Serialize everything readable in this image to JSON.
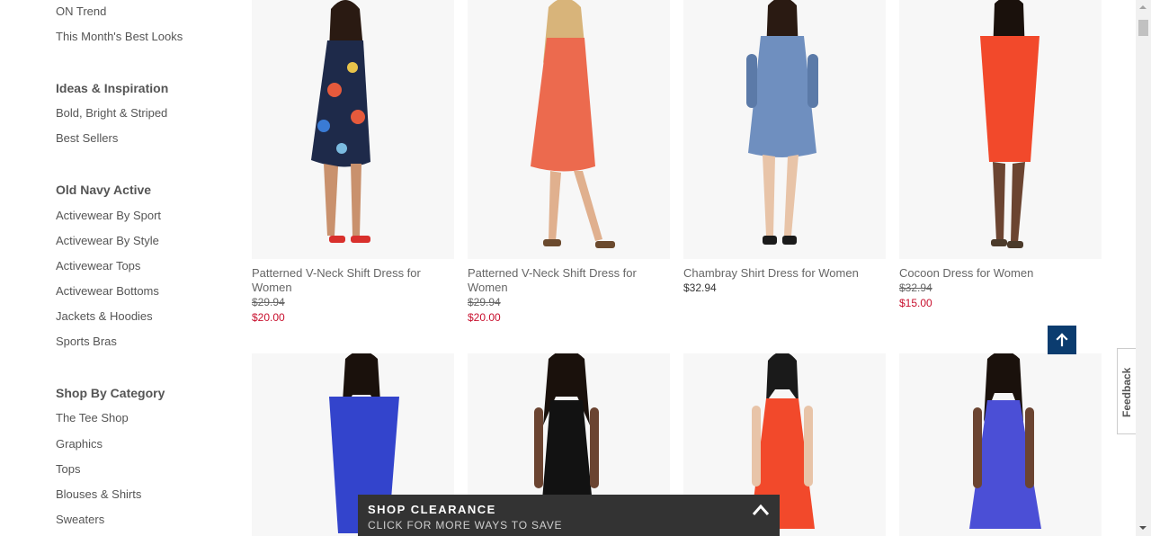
{
  "sidebar": {
    "top_links": [
      "ON Trend",
      "This Month's Best Looks"
    ],
    "sections": [
      {
        "heading": "Ideas & Inspiration",
        "links": [
          "Bold, Bright & Striped",
          "Best Sellers"
        ]
      },
      {
        "heading": "Old Navy Active",
        "links": [
          "Activewear By Sport",
          "Activewear By Style",
          "Activewear Tops",
          "Activewear Bottoms",
          "Jackets & Hoodies",
          "Sports Bras"
        ]
      },
      {
        "heading": "Shop By Category",
        "links": [
          "The Tee Shop",
          "Graphics",
          "Tops",
          "Blouses & Shirts",
          "Sweaters"
        ]
      }
    ]
  },
  "products": [
    {
      "name": "Patterned V-Neck Shift Dress for Women",
      "old_price": "$29.94",
      "sale_price": "$20.00",
      "dress_color": "#1e2a4a",
      "accent": "#e65a3c",
      "shoe_color": "#d9302c"
    },
    {
      "name": "Patterned V-Neck Shift Dress for Women",
      "old_price": "$29.94",
      "sale_price": "$20.00",
      "dress_color": "#ec6a4e",
      "accent": "#f7c4b0",
      "shoe_color": "#6b4a2e"
    },
    {
      "name": "Chambray Shirt Dress for Women",
      "price": "$32.94",
      "dress_color": "#6f8fbf",
      "accent": "#5b7aa8",
      "shoe_color": "#1a1a1a"
    },
    {
      "name": "Cocoon Dress for Women",
      "old_price": "$32.94",
      "sale_price": "$15.00",
      "dress_color": "#f2492b",
      "accent": "#e63e22",
      "shoe_color": "#4b3a2a"
    },
    {
      "dress_color": "#3344cc"
    },
    {
      "dress_color": "#121212"
    },
    {
      "dress_color": "#f2492b"
    },
    {
      "dress_color": "#4b4fd6"
    }
  ],
  "back_to_top": {
    "icon": "arrow-up-icon"
  },
  "feedback": {
    "label": "Feedback"
  },
  "clearance": {
    "title": "SHOP CLEARANCE",
    "subtitle": "CLICK FOR MORE WAYS TO SAVE",
    "icon": "chevron-up-icon"
  }
}
